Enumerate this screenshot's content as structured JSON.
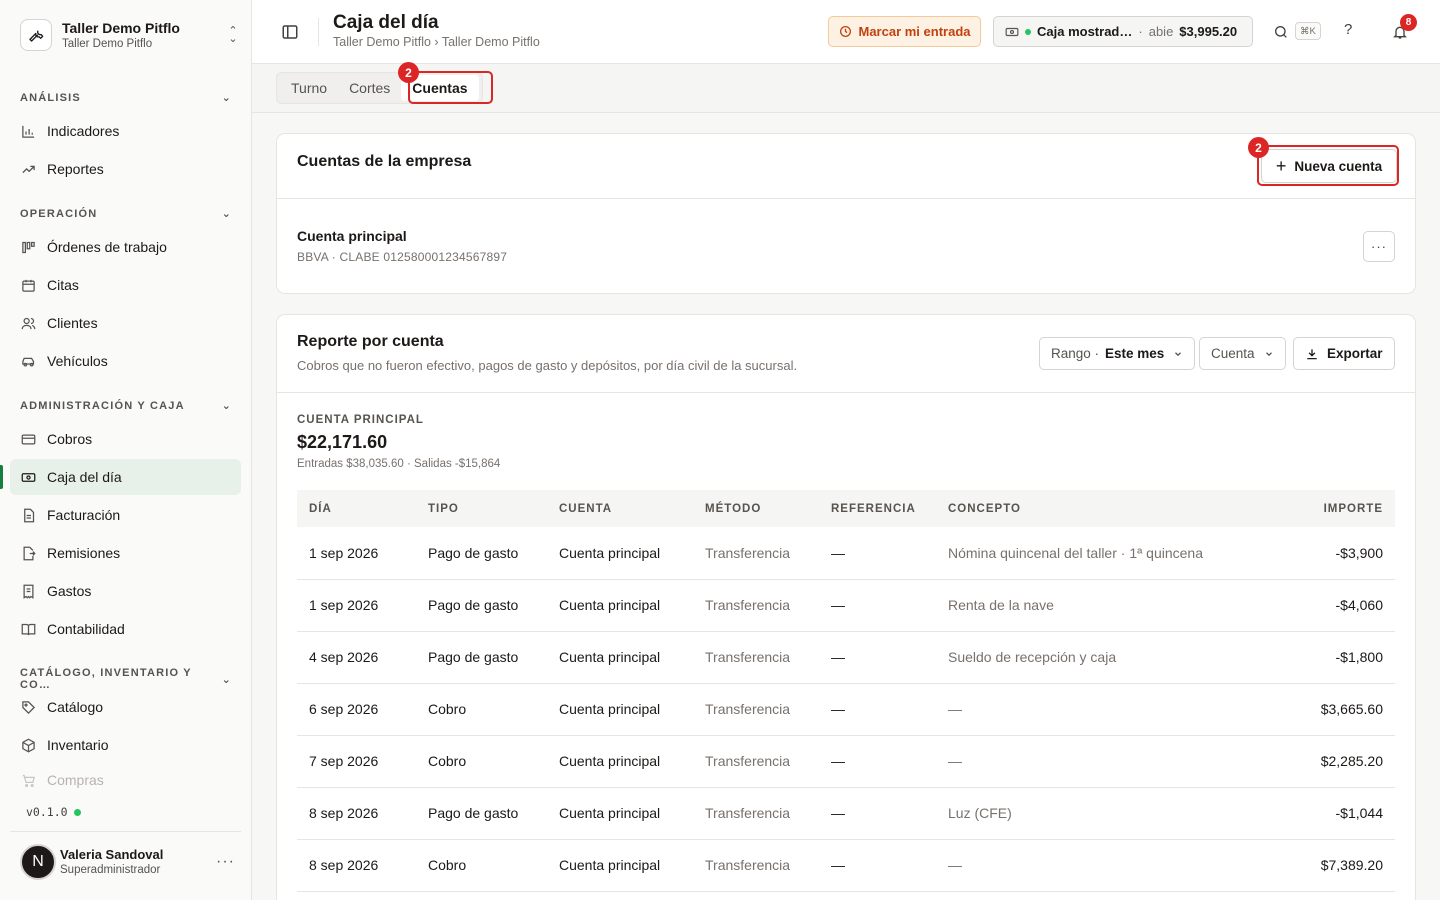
{
  "org": {
    "name": "Taller Demo Pitflo",
    "sub": "Taller Demo Pitflo"
  },
  "sidebar": {
    "sections": [
      {
        "title": "ANÁLISIS"
      },
      {
        "title": "OPERACIÓN"
      },
      {
        "title": "ADMINISTRACIÓN Y CAJA"
      },
      {
        "title": "CATÁLOGO, INVENTARIO Y CO…"
      }
    ],
    "items": [
      {
        "label": "Indicadores",
        "icon": "bar-chart-icon"
      },
      {
        "label": "Reportes",
        "icon": "trending-up-icon"
      },
      {
        "label": "Órdenes de trabajo",
        "icon": "kanban-icon"
      },
      {
        "label": "Citas",
        "icon": "calendar-icon"
      },
      {
        "label": "Clientes",
        "icon": "users-icon"
      },
      {
        "label": "Vehículos",
        "icon": "car-icon"
      },
      {
        "label": "Cobros",
        "icon": "credit-card-icon"
      },
      {
        "label": "Caja del día",
        "icon": "cash-register-icon"
      },
      {
        "label": "Facturación",
        "icon": "file-text-icon"
      },
      {
        "label": "Remisiones",
        "icon": "file-export-icon"
      },
      {
        "label": "Gastos",
        "icon": "receipt-icon"
      },
      {
        "label": "Contabilidad",
        "icon": "book-open-icon"
      },
      {
        "label": "Catálogo",
        "icon": "tag-icon"
      },
      {
        "label": "Inventario",
        "icon": "box-icon"
      },
      {
        "label": "Compras",
        "icon": "cart-icon"
      }
    ],
    "version": "v0.1.0",
    "user": {
      "initial": "N",
      "name": "Valeria Sandoval",
      "role": "Superadministrador"
    }
  },
  "header": {
    "title": "Caja del día",
    "breadcrumb": "Taller Demo Pitflo › Taller Demo Pitflo",
    "clock_in": "Marcar mi entrada",
    "caja": {
      "name": "Caja mostrad…",
      "status": "abie",
      "amount": "$3,995.20"
    },
    "shortcut": "⌘K",
    "help": "?",
    "notifications": "8"
  },
  "tabs": [
    "Turno",
    "Cortes",
    "Cuentas"
  ],
  "annotations": {
    "tab_badge": "2",
    "button_badge": "2"
  },
  "accounts_card": {
    "title": "Cuentas de la empresa",
    "new_button": "Nueva cuenta",
    "account": {
      "name": "Cuenta principal",
      "detail": "BBVA · CLABE 012580001234567897"
    }
  },
  "report": {
    "title": "Reporte por cuenta",
    "subtitle": "Cobros que no fueron efectivo, pagos de gasto y depósitos, por día civil de la sucursal.",
    "range_label": "Rango ·",
    "range_value": "Este mes",
    "account_filter": "Cuenta",
    "export": "Exportar",
    "account_label": "CUENTA PRINCIPAL",
    "total": "$22,171.60",
    "flow": "Entradas $38,035.60 · Salidas -$15,864",
    "columns": [
      "DÍA",
      "TIPO",
      "CUENTA",
      "MÉTODO",
      "REFERENCIA",
      "CONCEPTO",
      "IMPORTE"
    ],
    "rows": [
      [
        "1 sep 2026",
        "Pago de gasto",
        "Cuenta principal",
        "Transferencia",
        "—",
        "Nómina quincenal del taller · 1ª quincena",
        "-$3,900"
      ],
      [
        "1 sep 2026",
        "Pago de gasto",
        "Cuenta principal",
        "Transferencia",
        "—",
        "Renta de la nave",
        "-$4,060"
      ],
      [
        "4 sep 2026",
        "Pago de gasto",
        "Cuenta principal",
        "Transferencia",
        "—",
        "Sueldo de recepción y caja",
        "-$1,800"
      ],
      [
        "6 sep 2026",
        "Cobro",
        "Cuenta principal",
        "Transferencia",
        "—",
        "—",
        "$3,665.60"
      ],
      [
        "7 sep 2026",
        "Cobro",
        "Cuenta principal",
        "Transferencia",
        "—",
        "—",
        "$2,285.20"
      ],
      [
        "8 sep 2026",
        "Pago de gasto",
        "Cuenta principal",
        "Transferencia",
        "—",
        "Luz (CFE)",
        "-$1,044"
      ],
      [
        "8 sep 2026",
        "Cobro",
        "Cuenta principal",
        "Transferencia",
        "—",
        "—",
        "$7,389.20"
      ]
    ]
  }
}
